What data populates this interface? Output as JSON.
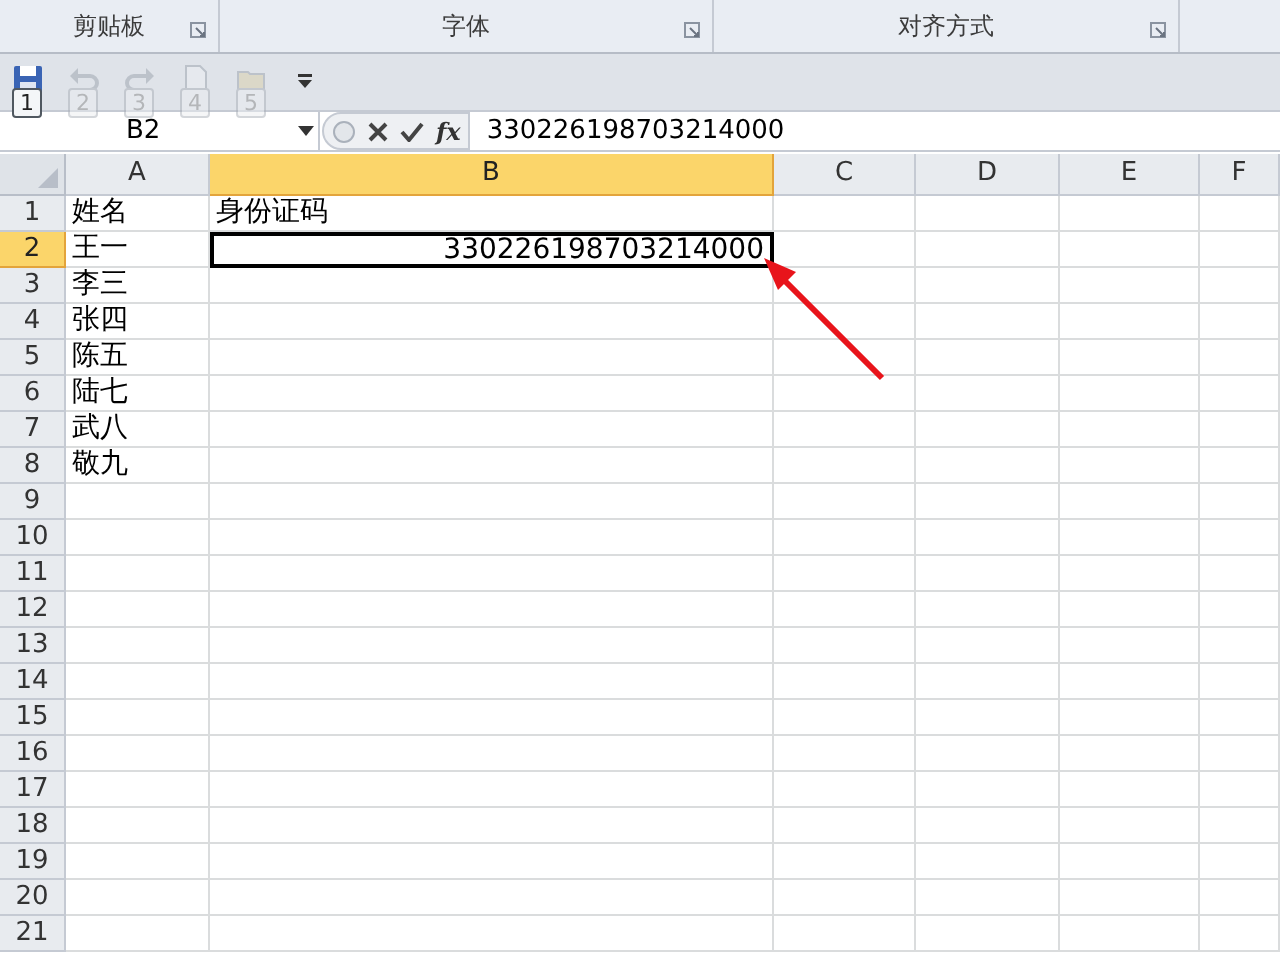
{
  "ribbon_groups": [
    {
      "label": "剪贴板"
    },
    {
      "label": "字体"
    },
    {
      "label": "对齐方式"
    }
  ],
  "quick_access": [
    {
      "kind": "save",
      "keytip": "1",
      "disabled": false
    },
    {
      "kind": "undo",
      "keytip": "2",
      "disabled": true
    },
    {
      "kind": "redo",
      "keytip": "3",
      "disabled": true
    },
    {
      "kind": "new",
      "keytip": "4",
      "disabled": true
    },
    {
      "kind": "open",
      "keytip": "5",
      "disabled": true
    }
  ],
  "name_box": "B2",
  "insert_function": "fx",
  "formula": "330226198703214000",
  "columns": [
    {
      "label": "A",
      "selected": false
    },
    {
      "label": "B",
      "selected": true
    },
    {
      "label": "C",
      "selected": false
    },
    {
      "label": "D",
      "selected": false
    },
    {
      "label": "E",
      "selected": false
    },
    {
      "label": "F",
      "selected": false
    }
  ],
  "rows": [
    {
      "number": "1",
      "selected": false,
      "cells": [
        {
          "text": "姓名",
          "kind": "text",
          "selected": false
        },
        {
          "text": "身份证码",
          "kind": "text",
          "selected": false
        }
      ]
    },
    {
      "number": "2",
      "selected": true,
      "cells": [
        {
          "text": "王一",
          "kind": "text",
          "selected": false
        },
        {
          "text": "330226198703214000",
          "kind": "number",
          "selected": true
        }
      ]
    },
    {
      "number": "3",
      "selected": false,
      "cells": [
        {
          "text": "李三",
          "kind": "text",
          "selected": false
        }
      ]
    },
    {
      "number": "4",
      "selected": false,
      "cells": [
        {
          "text": "张四",
          "kind": "text",
          "selected": false
        }
      ]
    },
    {
      "number": "5",
      "selected": false,
      "cells": [
        {
          "text": "陈五",
          "kind": "text",
          "selected": false
        }
      ]
    },
    {
      "number": "6",
      "selected": false,
      "cells": [
        {
          "text": "陆七",
          "kind": "text",
          "selected": false
        }
      ]
    },
    {
      "number": "7",
      "selected": false,
      "cells": [
        {
          "text": "武八",
          "kind": "text",
          "selected": false
        }
      ]
    },
    {
      "number": "8",
      "selected": false,
      "cells": [
        {
          "text": "敬九",
          "kind": "text",
          "selected": false
        }
      ]
    },
    {
      "number": "9",
      "selected": false
    },
    {
      "number": "10",
      "selected": false
    },
    {
      "number": "11",
      "selected": false
    },
    {
      "number": "12",
      "selected": false
    },
    {
      "number": "13",
      "selected": false
    },
    {
      "number": "14",
      "selected": false
    },
    {
      "number": "15",
      "selected": false
    },
    {
      "number": "16",
      "selected": false
    },
    {
      "number": "17",
      "selected": false
    },
    {
      "number": "18",
      "selected": false
    },
    {
      "number": "19",
      "selected": false
    },
    {
      "number": "20",
      "selected": false
    },
    {
      "number": "21",
      "selected": false
    }
  ],
  "annotation": {
    "kind": "arrow",
    "color": "#e8141b"
  }
}
